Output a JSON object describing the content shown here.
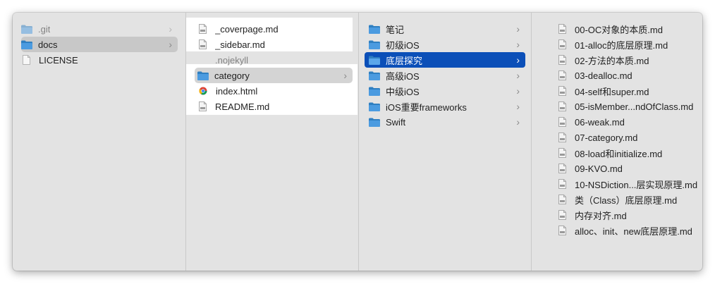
{
  "col1": {
    "items": [
      {
        "name": ".git",
        "icon": "folder",
        "chevron": true
      },
      {
        "name": "docs",
        "icon": "folder",
        "chevron": true
      },
      {
        "name": "LICENSE",
        "icon": "document",
        "chevron": false
      }
    ]
  },
  "col2": {
    "items": [
      {
        "name": "_coverpage.md",
        "icon": "markdown"
      },
      {
        "name": "_sidebar.md",
        "icon": "markdown"
      },
      {
        "name": ".nojekyll",
        "icon": "document"
      },
      {
        "name": "category",
        "icon": "folder",
        "chevron": true
      },
      {
        "name": "index.html",
        "icon": "chrome"
      },
      {
        "name": "README.md",
        "icon": "markdown"
      }
    ]
  },
  "col3": {
    "items": [
      {
        "name": "笔记",
        "icon": "folder",
        "chevron": true
      },
      {
        "name": "初级iOS",
        "icon": "folder",
        "chevron": true
      },
      {
        "name": "底层探究",
        "icon": "folder",
        "chevron": true
      },
      {
        "name": "高级iOS",
        "icon": "folder",
        "chevron": true
      },
      {
        "name": "中级iOS",
        "icon": "folder",
        "chevron": true
      },
      {
        "name": "iOS重要frameworks",
        "icon": "folder",
        "chevron": true
      },
      {
        "name": "Swift",
        "icon": "folder",
        "chevron": true
      }
    ]
  },
  "col4": {
    "items": [
      {
        "name": "00-OC对象的本质.md",
        "icon": "markdown"
      },
      {
        "name": "01-alloc的底层原理.md",
        "icon": "markdown"
      },
      {
        "name": "02-方法的本质.md",
        "icon": "markdown"
      },
      {
        "name": "03-dealloc.md",
        "icon": "markdown"
      },
      {
        "name": "04-self和super.md",
        "icon": "markdown"
      },
      {
        "name": "05-isMember...ndOfClass.md",
        "icon": "markdown"
      },
      {
        "name": "06-weak.md",
        "icon": "markdown"
      },
      {
        "name": "07-category.md",
        "icon": "markdown"
      },
      {
        "name": "08-load和initialize.md",
        "icon": "markdown"
      },
      {
        "name": "09-KVO.md",
        "icon": "markdown"
      },
      {
        "name": "10-NSDiction...层实现原理.md",
        "icon": "markdown"
      },
      {
        "name": "类（Class）底层原理.md",
        "icon": "markdown"
      },
      {
        "name": "内存对齐.md",
        "icon": "markdown"
      },
      {
        "name": "alloc、init、new底层原理.md",
        "icon": "markdown"
      }
    ]
  },
  "chevron_glyph": "›",
  "colors": {
    "folder": "#2f7fc1",
    "selection_blue": "#0b4fb8",
    "selection_gray": "#c8c8c8",
    "window_bg": "#e3e3e3"
  }
}
